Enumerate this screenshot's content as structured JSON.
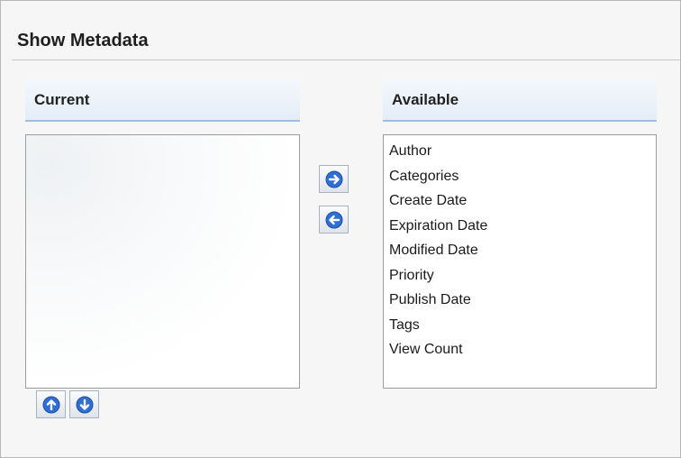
{
  "panel": {
    "title": "Show Metadata"
  },
  "current": {
    "header": "Current",
    "items": []
  },
  "available": {
    "header": "Available",
    "items": [
      "Author",
      "Categories",
      "Create Date",
      "Expiration Date",
      "Modified Date",
      "Priority",
      "Publish Date",
      "Tags",
      "View Count"
    ]
  },
  "buttons": {
    "move_right": {
      "icon": "arrow-right-icon"
    },
    "move_left": {
      "icon": "arrow-left-icon"
    },
    "move_up": {
      "icon": "arrow-up-icon"
    },
    "move_down": {
      "icon": "arrow-down-icon"
    }
  },
  "colors": {
    "icon_blue": "#2f6ed3",
    "header_border": "#9fbce3"
  }
}
